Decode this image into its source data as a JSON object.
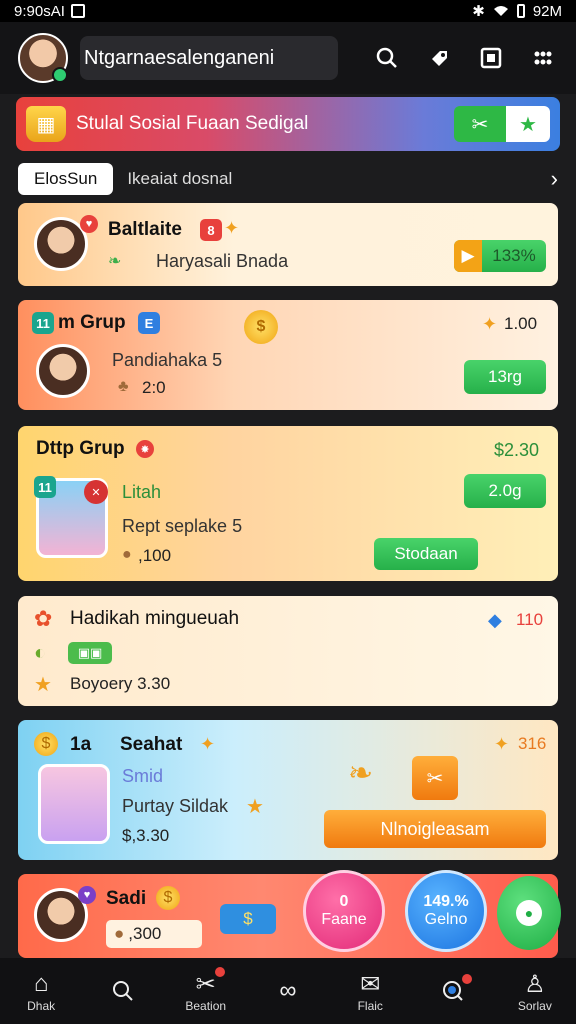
{
  "status_bar": {
    "time": "9:90sAI",
    "right": "92M"
  },
  "app_bar": {
    "title": "Ntgarnaesalenganeni"
  },
  "banner": {
    "text": "Stulal Sosial Fuaan Sedigal"
  },
  "filters": {
    "chip": "ElosSun",
    "label": "Ikeaiat dosnal"
  },
  "cards": [
    {
      "title": "Baltlaite",
      "subtitle": "Haryasali Bnada",
      "value": "133%"
    },
    {
      "title": "m Grup",
      "value_top": "1.00",
      "name": "Pandiahaka 5",
      "amount": "2:0",
      "button": "13rg"
    },
    {
      "title": "Dttp Grup",
      "value_top": "$2.30",
      "status": "Litah",
      "value_pill": "2.0g",
      "name": "Rept seplake 5",
      "amount": ",100",
      "button": "Stodaan"
    },
    {
      "title": "Hadikah mingueuah",
      "value_top": "110",
      "line": "Boyoery 3.30"
    },
    {
      "title": "Seahat",
      "title_prefix": "1a",
      "value_top": "316",
      "line1": "Smid",
      "line2": "Purtay Sildak",
      "amount": "$,3.30",
      "button": "Nlnoigleasam"
    },
    {
      "title": "Sadi",
      "amount": ",300"
    }
  ],
  "circle_buttons": [
    {
      "top": "0",
      "label": "Faane"
    },
    {
      "top": "149.%",
      "label": "Gelno"
    }
  ],
  "nav": [
    {
      "icon": "home-icon",
      "label": "Dhak"
    },
    {
      "icon": "search-icon",
      "label": ""
    },
    {
      "icon": "tools-icon",
      "label": "Beation"
    },
    {
      "icon": "link-icon",
      "label": ""
    },
    {
      "icon": "mail-icon",
      "label": "Flaic"
    },
    {
      "icon": "chat-icon",
      "label": ""
    },
    {
      "icon": "profile-icon",
      "label": "Sorlav"
    }
  ]
}
